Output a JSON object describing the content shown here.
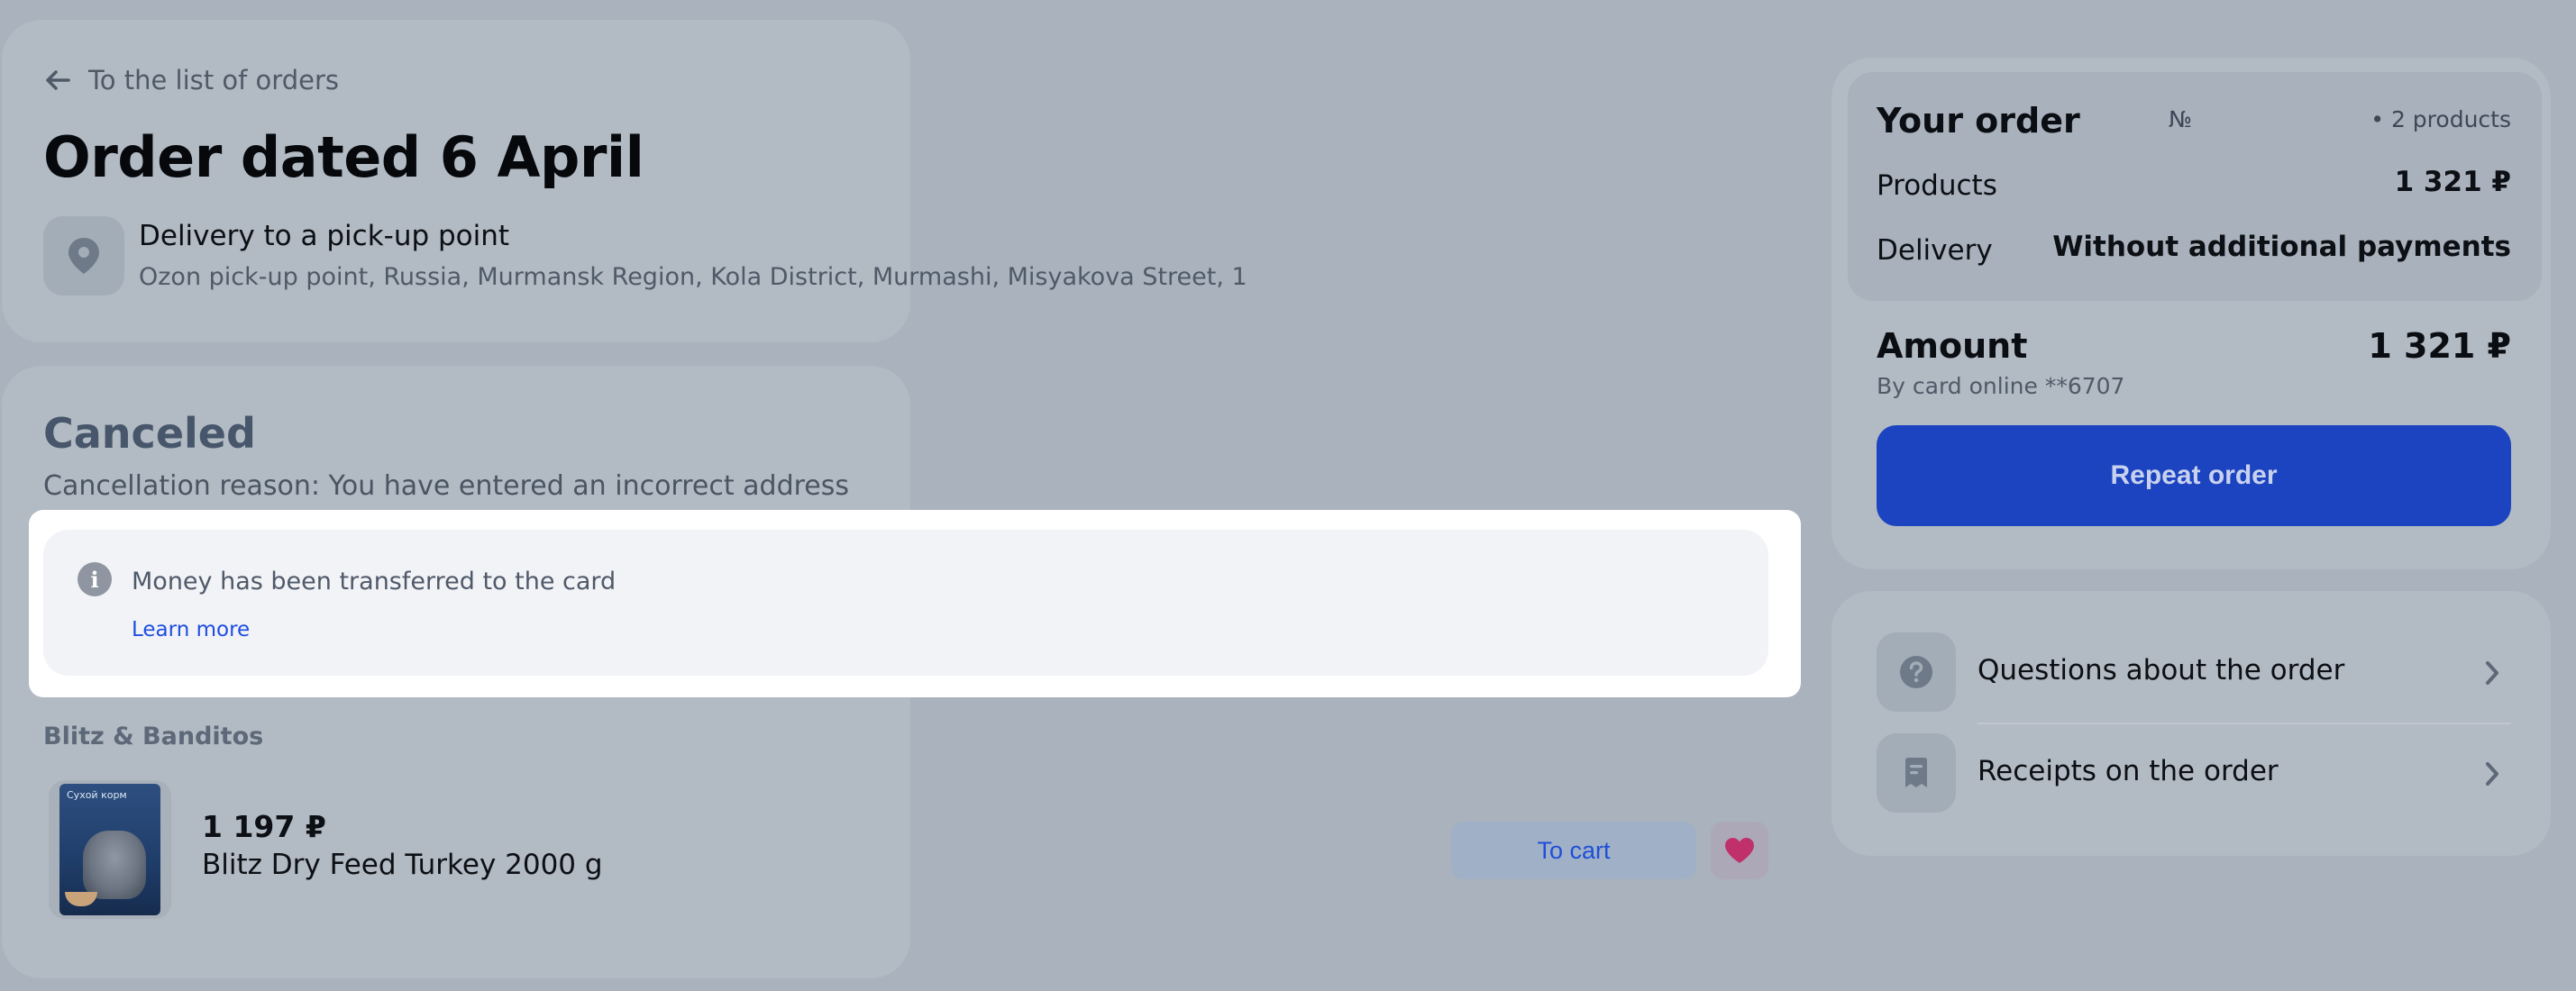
{
  "header": {
    "back_label": "To the list of orders",
    "title": "Order dated 6 April",
    "delivery_title": "Delivery to a pick-up point",
    "delivery_address": "Ozon pick-up point, Russia, Murmansk Region, Kola District, Murmashi, Misyakova Street, 1"
  },
  "status": {
    "title": "Canceled",
    "reason": "Cancellation reason: You have entered an incorrect address",
    "info_icon": "i",
    "info_text": "Money has been transferred to the card",
    "learn_more": "Learn more"
  },
  "items": {
    "seller": "Blitz & Banditos",
    "product": {
      "image_label": "Сухой корм",
      "price": "1 197 ₽",
      "name": "Blitz Dry Feed Turkey 2000 g",
      "to_cart": "To cart"
    }
  },
  "summary": {
    "title": "Your order",
    "number_label": "№",
    "product_count": "• 2 products",
    "products_label": "Products",
    "products_value": "1 321 ₽",
    "delivery_label": "Delivery",
    "delivery_value": "Without additional payments",
    "amount_label": "Amount",
    "amount_value": "1 321 ₽",
    "payment_method": "By card online **6707",
    "repeat_button": "Repeat order"
  },
  "help": {
    "questions_label": "Questions about the order",
    "receipts_label": "Receipts on the order"
  },
  "colors": {
    "accent": "#1c44c0",
    "link": "#1e4ee0",
    "favorite": "#c0306a"
  },
  "icons": [
    "arrow-left-icon",
    "map-pin-icon",
    "info-icon",
    "heart-icon",
    "question-icon",
    "receipt-icon",
    "chevron-right-icon"
  ]
}
